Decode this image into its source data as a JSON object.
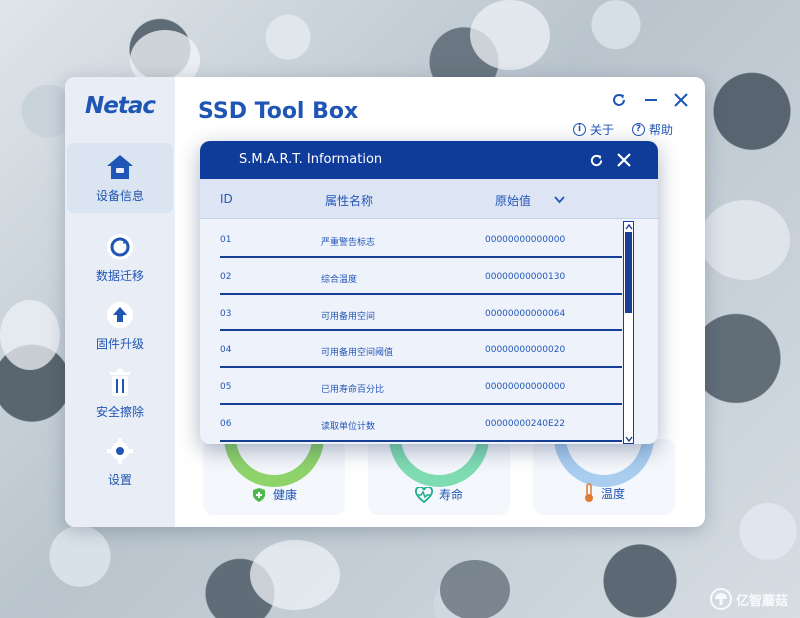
{
  "app": {
    "logo": "Netac",
    "title": "SSD Tool Box"
  },
  "header": {
    "about_label": "关于",
    "help_label": "帮助"
  },
  "sidebar": {
    "items": [
      {
        "label": "设备信息",
        "icon": "device-info-icon",
        "active": true
      },
      {
        "label": "数据迁移",
        "icon": "data-migration-icon",
        "active": false
      },
      {
        "label": "固件升级",
        "icon": "firmware-upgrade-icon",
        "active": false
      },
      {
        "label": "安全擦除",
        "icon": "trash-icon",
        "active": false
      },
      {
        "label": "设置",
        "icon": "gear-icon",
        "active": false
      }
    ]
  },
  "cards": [
    {
      "label": "健康",
      "icon": "health-icon",
      "color": "#8fd36b"
    },
    {
      "label": "寿命",
      "icon": "heartbeat-icon",
      "color": "#7edbb2"
    },
    {
      "label": "温度",
      "icon": "thermometer-icon",
      "color": "#a8cdef"
    }
  ],
  "dialog": {
    "title": "S.M.A.R.T. Information",
    "columns": {
      "id": "ID",
      "name": "属性名称",
      "value": "原始值"
    },
    "rows": [
      {
        "id": "01",
        "name": "严重警告标志",
        "value": "00000000000000"
      },
      {
        "id": "02",
        "name": "综合温度",
        "value": "00000000000130"
      },
      {
        "id": "03",
        "name": "可用备用空间",
        "value": "00000000000064"
      },
      {
        "id": "04",
        "name": "可用备用空间阈值",
        "value": "00000000000020"
      },
      {
        "id": "05",
        "name": "已用寿命百分比",
        "value": "00000000000000"
      },
      {
        "id": "06",
        "name": "读取单位计数",
        "value": "00000000240E22"
      }
    ]
  },
  "watermark": {
    "text": "亿智蘑菇"
  },
  "colors": {
    "brand": "#1f55b4",
    "dialog_bar": "#0f3c9b",
    "row_divider": "#183f97"
  }
}
